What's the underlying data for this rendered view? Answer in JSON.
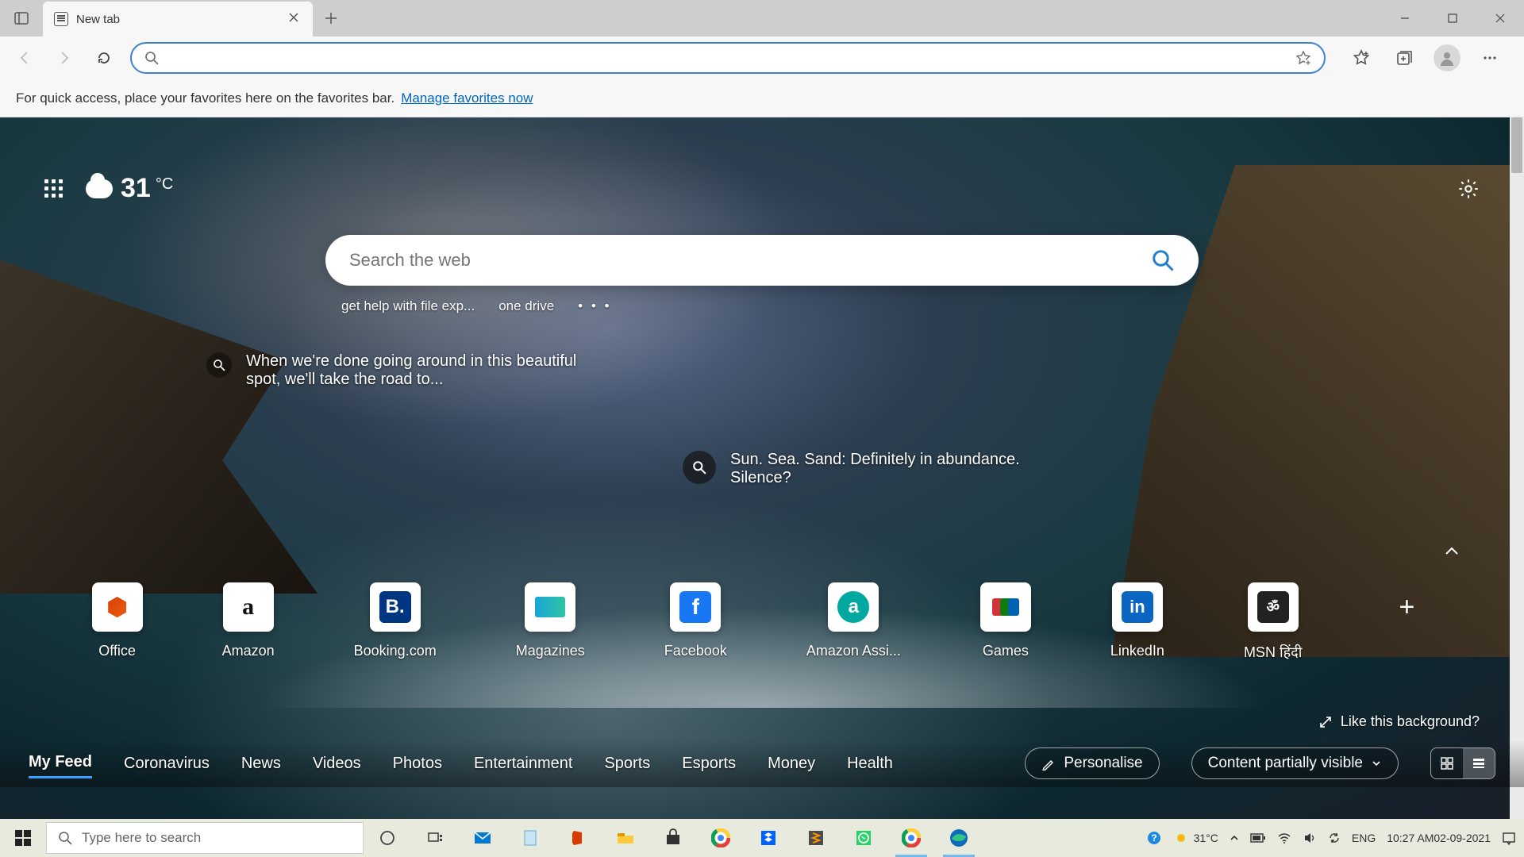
{
  "titlebar": {
    "tab_title": "New tab"
  },
  "toolbar": {
    "addressbar_value": ""
  },
  "favbar": {
    "text": "For quick access, place your favorites here on the favorites bar.",
    "link": "Manage favorites now"
  },
  "weather": {
    "temp": "31",
    "unit": "°C"
  },
  "search": {
    "placeholder": "Search the web"
  },
  "quick_links": [
    "get help with file exp...",
    "one drive"
  ],
  "stories": {
    "left": "When we're done going around in this beautiful spot, we'll take the road to...",
    "mid": "Sun. Sea. Sand: Definitely in abundance. Silence?"
  },
  "tiles": [
    {
      "label": "Office",
      "icon": "office"
    },
    {
      "label": "Amazon",
      "icon": "amazon"
    },
    {
      "label": "Booking.com",
      "icon": "booking"
    },
    {
      "label": "Magazines",
      "icon": "magazines"
    },
    {
      "label": "Facebook",
      "icon": "facebook"
    },
    {
      "label": "Amazon Assi...",
      "icon": "amazon-assist"
    },
    {
      "label": "Games",
      "icon": "games"
    },
    {
      "label": "LinkedIn",
      "icon": "linkedin"
    },
    {
      "label": "MSN हिंदी",
      "icon": "msn"
    }
  ],
  "like_bg": "Like this background?",
  "feed": {
    "links": [
      "My Feed",
      "Coronavirus",
      "News",
      "Videos",
      "Photos",
      "Entertainment",
      "Sports",
      "Esports",
      "Money",
      "Health"
    ],
    "active": "My Feed",
    "personalise": "Personalise",
    "content_visible": "Content partially visible"
  },
  "taskbar": {
    "search_placeholder": "Type here to search",
    "tray_temp": "31°C",
    "lang": "ENG",
    "time": "10:27 AM",
    "date": "02-09-2021"
  }
}
